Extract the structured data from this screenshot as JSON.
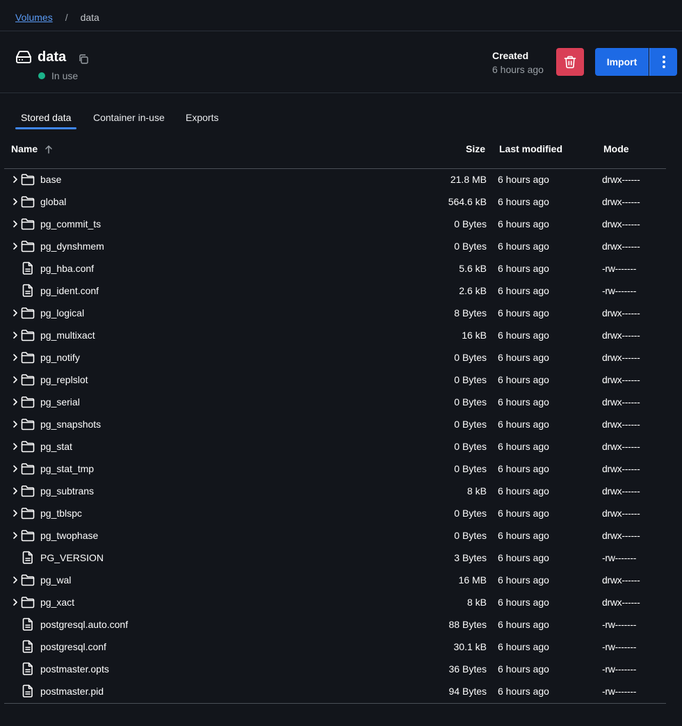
{
  "breadcrumb": {
    "parent": "Volumes",
    "separator": "/",
    "current": "data"
  },
  "volume": {
    "name": "data",
    "status": "In use",
    "status_color": "#1bb38a",
    "icon": "hard-drive-icon"
  },
  "created": {
    "label": "Created",
    "value": "6 hours ago"
  },
  "actions": {
    "delete_icon": "trash-icon",
    "delete_color": "#d93f56",
    "import_label": "Import",
    "import_color": "#1d6ae5",
    "more_icon": "kebab-vertical-icon"
  },
  "tabs": [
    {
      "label": "Stored data",
      "active": true
    },
    {
      "label": "Container in-use",
      "active": false
    },
    {
      "label": "Exports",
      "active": false
    }
  ],
  "table": {
    "headers": {
      "name": "Name",
      "size": "Size",
      "modified": "Last modified",
      "mode": "Mode"
    },
    "sort": {
      "column": "Name",
      "direction": "ascending"
    },
    "rows": [
      {
        "type": "folder",
        "name": "base",
        "size": "21.8 MB",
        "modified": "6 hours ago",
        "mode": "drwx------"
      },
      {
        "type": "folder",
        "name": "global",
        "size": "564.6 kB",
        "modified": "6 hours ago",
        "mode": "drwx------"
      },
      {
        "type": "folder",
        "name": "pg_commit_ts",
        "size": "0 Bytes",
        "modified": "6 hours ago",
        "mode": "drwx------"
      },
      {
        "type": "folder",
        "name": "pg_dynshmem",
        "size": "0 Bytes",
        "modified": "6 hours ago",
        "mode": "drwx------"
      },
      {
        "type": "file",
        "name": "pg_hba.conf",
        "size": "5.6 kB",
        "modified": "6 hours ago",
        "mode": "-rw-------"
      },
      {
        "type": "file",
        "name": "pg_ident.conf",
        "size": "2.6 kB",
        "modified": "6 hours ago",
        "mode": "-rw-------"
      },
      {
        "type": "folder",
        "name": "pg_logical",
        "size": "8 Bytes",
        "modified": "6 hours ago",
        "mode": "drwx------"
      },
      {
        "type": "folder",
        "name": "pg_multixact",
        "size": "16 kB",
        "modified": "6 hours ago",
        "mode": "drwx------"
      },
      {
        "type": "folder",
        "name": "pg_notify",
        "size": "0 Bytes",
        "modified": "6 hours ago",
        "mode": "drwx------"
      },
      {
        "type": "folder",
        "name": "pg_replslot",
        "size": "0 Bytes",
        "modified": "6 hours ago",
        "mode": "drwx------"
      },
      {
        "type": "folder",
        "name": "pg_serial",
        "size": "0 Bytes",
        "modified": "6 hours ago",
        "mode": "drwx------"
      },
      {
        "type": "folder",
        "name": "pg_snapshots",
        "size": "0 Bytes",
        "modified": "6 hours ago",
        "mode": "drwx------"
      },
      {
        "type": "folder",
        "name": "pg_stat",
        "size": "0 Bytes",
        "modified": "6 hours ago",
        "mode": "drwx------"
      },
      {
        "type": "folder",
        "name": "pg_stat_tmp",
        "size": "0 Bytes",
        "modified": "6 hours ago",
        "mode": "drwx------"
      },
      {
        "type": "folder",
        "name": "pg_subtrans",
        "size": "8 kB",
        "modified": "6 hours ago",
        "mode": "drwx------"
      },
      {
        "type": "folder",
        "name": "pg_tblspc",
        "size": "0 Bytes",
        "modified": "6 hours ago",
        "mode": "drwx------"
      },
      {
        "type": "folder",
        "name": "pg_twophase",
        "size": "0 Bytes",
        "modified": "6 hours ago",
        "mode": "drwx------"
      },
      {
        "type": "file",
        "name": "PG_VERSION",
        "size": "3 Bytes",
        "modified": "6 hours ago",
        "mode": "-rw-------"
      },
      {
        "type": "folder",
        "name": "pg_wal",
        "size": "16 MB",
        "modified": "6 hours ago",
        "mode": "drwx------"
      },
      {
        "type": "folder",
        "name": "pg_xact",
        "size": "8 kB",
        "modified": "6 hours ago",
        "mode": "drwx------"
      },
      {
        "type": "file",
        "name": "postgresql.auto.conf",
        "size": "88 Bytes",
        "modified": "6 hours ago",
        "mode": "-rw-------"
      },
      {
        "type": "file",
        "name": "postgresql.conf",
        "size": "30.1 kB",
        "modified": "6 hours ago",
        "mode": "-rw-------"
      },
      {
        "type": "file",
        "name": "postmaster.opts",
        "size": "36 Bytes",
        "modified": "6 hours ago",
        "mode": "-rw-------"
      },
      {
        "type": "file",
        "name": "postmaster.pid",
        "size": "94 Bytes",
        "modified": "6 hours ago",
        "mode": "-rw-------"
      }
    ]
  }
}
